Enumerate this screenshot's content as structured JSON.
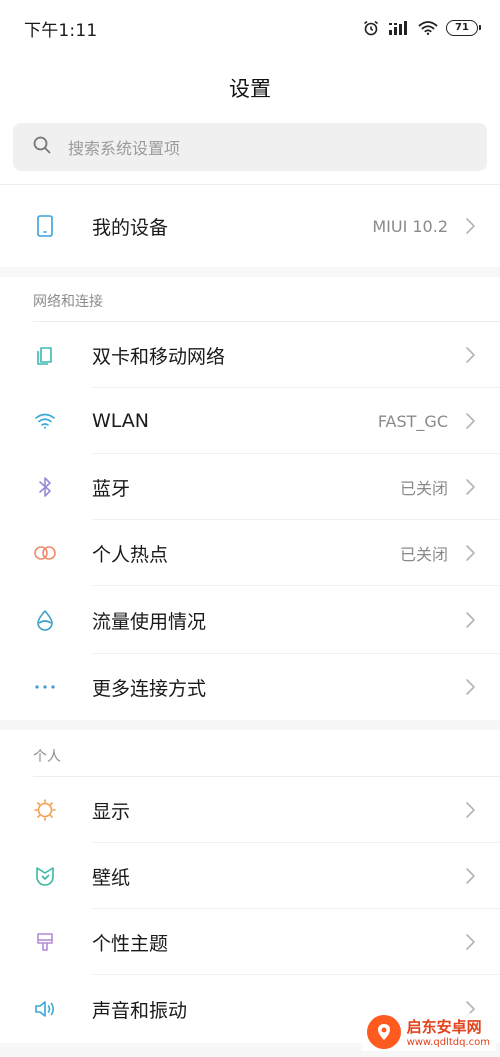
{
  "status_bar": {
    "time": "下午1:11",
    "battery": "71"
  },
  "header": {
    "title": "设置"
  },
  "search": {
    "placeholder": "搜索系统设置项"
  },
  "device": {
    "label": "我的设备",
    "value": "MIUI 10.2"
  },
  "sections": {
    "network": {
      "title": "网络和连接",
      "items": [
        {
          "label": "双卡和移动网络",
          "value": ""
        },
        {
          "label": "WLAN",
          "value": "FAST_GC"
        },
        {
          "label": "蓝牙",
          "value": "已关闭"
        },
        {
          "label": "个人热点",
          "value": "已关闭"
        },
        {
          "label": "流量使用情况",
          "value": ""
        },
        {
          "label": "更多连接方式",
          "value": ""
        }
      ]
    },
    "personal": {
      "title": "个人",
      "items": [
        {
          "label": "显示",
          "value": ""
        },
        {
          "label": "壁纸",
          "value": ""
        },
        {
          "label": "个性主题",
          "value": ""
        },
        {
          "label": "声音和振动",
          "value": ""
        }
      ]
    }
  },
  "watermark": {
    "name": "启东安卓网",
    "url": "www.qdltdq.com"
  },
  "colors": {
    "device_icon": "#3aa0d8",
    "sim_icon": "#3cb8b0",
    "wlan_icon": "#3aa8d8",
    "bluetooth_icon": "#9a8ad6",
    "hotspot_icon": "#f08a6a",
    "data_icon": "#3aa0c8",
    "more_icon": "#3a9ad8",
    "display_icon": "#f0a050",
    "wallpaper_icon": "#3cb8a0",
    "theme_icon": "#b48ad8",
    "sound_icon": "#3aa8d8",
    "watermark": "#ff5a1f"
  }
}
